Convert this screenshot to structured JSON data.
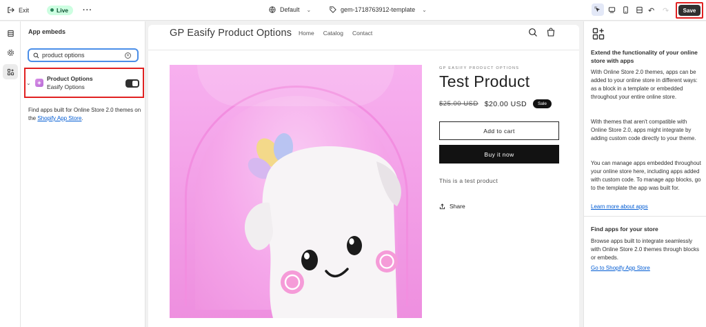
{
  "topbar": {
    "exit_label": "Exit",
    "live_label": "Live",
    "theme_name": "Default",
    "template_name": "gem-1718763912-template",
    "save_label": "Save"
  },
  "sidebar": {
    "title": "App embeds",
    "search": {
      "value": "product options",
      "placeholder": "Search app embeds"
    },
    "embed": {
      "name": "Product Options",
      "vendor": "Easify Options",
      "enabled": true
    },
    "find_text": "Find apps built for Online Store 2.0 themes on the",
    "find_link": "Shopify App Store",
    "find_suffix": "."
  },
  "store": {
    "name": "GP Easify Product Options",
    "nav": [
      "Home",
      "Catalog",
      "Contact"
    ]
  },
  "product": {
    "vendor": "GP EASIFY PRODUCT OPTIONS",
    "title": "Test Product",
    "old_price": "$25.00 USD",
    "price": "$20.00 USD",
    "badge": "Sale",
    "add_to_cart": "Add to cart",
    "buy_now": "Buy it now",
    "description": "This is a test product",
    "share": "Share"
  },
  "right_panel": {
    "heading": "Extend the functionality of your online store with apps",
    "p1": "With Online Store 2.0 themes, apps can be added to your online store in different ways: as a block in a template or embedded throughout your entire online store.",
    "p2": "With themes that aren't compatible with Online Store 2.0, apps might integrate by adding custom code directly to your theme.",
    "p3": "You can manage apps embedded throughout your online store here, including apps added with custom code. To manage app blocks, go to the template the app was built for.",
    "link1": "Learn more about apps",
    "heading2": "Find apps for your store",
    "p4": "Browse apps built to integrate seamlessly with Online Store 2.0 themes through blocks or embeds.",
    "link2": "Go to Shopify App Store"
  },
  "colors": {
    "live_bg": "#cdfee1",
    "highlight": "#e02020",
    "link": "#005bd3",
    "product_bg": "#f5a7ea"
  }
}
